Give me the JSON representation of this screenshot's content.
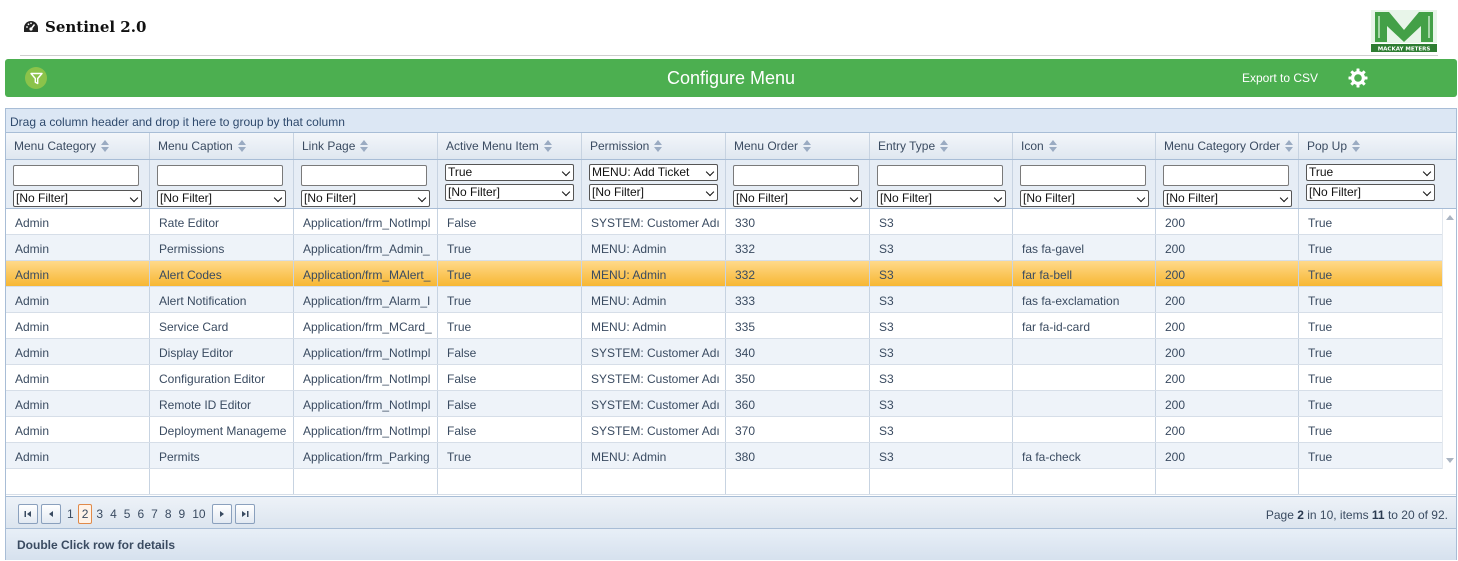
{
  "app": {
    "title": "Sentinel 2.0",
    "logo_text": "MACKAY METERS"
  },
  "toolbar": {
    "title": "Configure Menu",
    "export_label": "Export to CSV"
  },
  "grid": {
    "group_panel_hint": "Drag a column header and drop it here to group by that column",
    "columns": [
      {
        "label": "Menu Category"
      },
      {
        "label": "Menu Caption"
      },
      {
        "label": "Link Page"
      },
      {
        "label": "Active Menu Item"
      },
      {
        "label": "Permission"
      },
      {
        "label": "Menu Order"
      },
      {
        "label": "Entry Type"
      },
      {
        "label": "Icon"
      },
      {
        "label": "Menu Category Order"
      },
      {
        "label": "Pop Up"
      }
    ],
    "filters": {
      "no_filter": "[No Filter]",
      "active_value": "True",
      "permission_value": "MENU: Add Ticket",
      "popup_value": "True"
    },
    "rows": [
      [
        "Admin",
        "Rate Editor",
        "Application/frm_NotImpl",
        "False",
        "SYSTEM: Customer Adı",
        "330",
        "S3",
        "",
        "200",
        "True"
      ],
      [
        "Admin",
        "Permissions",
        "Application/frm_Admin_",
        "True",
        "MENU: Admin",
        "332",
        "S3",
        "fas fa-gavel",
        "200",
        "True"
      ],
      [
        "Admin",
        "Alert Codes",
        "Application/frm_MAlert_",
        "True",
        "MENU: Admin",
        "332",
        "S3",
        "far fa-bell",
        "200",
        "True"
      ],
      [
        "Admin",
        "Alert Notification",
        "Application/frm_Alarm_I",
        "True",
        "MENU: Admin",
        "333",
        "S3",
        "fas fa-exclamation",
        "200",
        "True"
      ],
      [
        "Admin",
        "Service Card",
        "Application/frm_MCard_",
        "True",
        "MENU: Admin",
        "335",
        "S3",
        "far fa-id-card",
        "200",
        "True"
      ],
      [
        "Admin",
        "Display Editor",
        "Application/frm_NotImpl",
        "False",
        "SYSTEM: Customer Adı",
        "340",
        "S3",
        "",
        "200",
        "True"
      ],
      [
        "Admin",
        "Configuration Editor",
        "Application/frm_NotImpl",
        "False",
        "SYSTEM: Customer Adı",
        "350",
        "S3",
        "",
        "200",
        "True"
      ],
      [
        "Admin",
        "Remote ID Editor",
        "Application/frm_NotImpl",
        "False",
        "SYSTEM: Customer Adı",
        "360",
        "S3",
        "",
        "200",
        "True"
      ],
      [
        "Admin",
        "Deployment Manageme",
        "Application/frm_NotImpl",
        "False",
        "SYSTEM: Customer Adı",
        "370",
        "S3",
        "",
        "200",
        "True"
      ],
      [
        "Admin",
        "Permits",
        "Application/frm_Parking",
        "True",
        "MENU: Admin",
        "380",
        "S3",
        "fa fa-check",
        "200",
        "True"
      ]
    ],
    "selected_row_index": 2
  },
  "pager": {
    "pages": [
      "1",
      "2",
      "3",
      "4",
      "5",
      "6",
      "7",
      "8",
      "9",
      "10"
    ],
    "current_page": "2",
    "info_prefix": "Page ",
    "info_page": "2",
    "info_mid1": " in 10, items ",
    "info_from": "11",
    "info_mid2": " to 20 of 92."
  },
  "footer": {
    "hint": "Double Click row for details"
  },
  "colors": {
    "toolbar": "#4caf50",
    "selected_row": "#f7b733",
    "grid_border": "#a8bdd6"
  },
  "icons": {
    "title_icon": "speedometer-icon",
    "filter": "funnel-icon",
    "settings": "gear-icon"
  }
}
